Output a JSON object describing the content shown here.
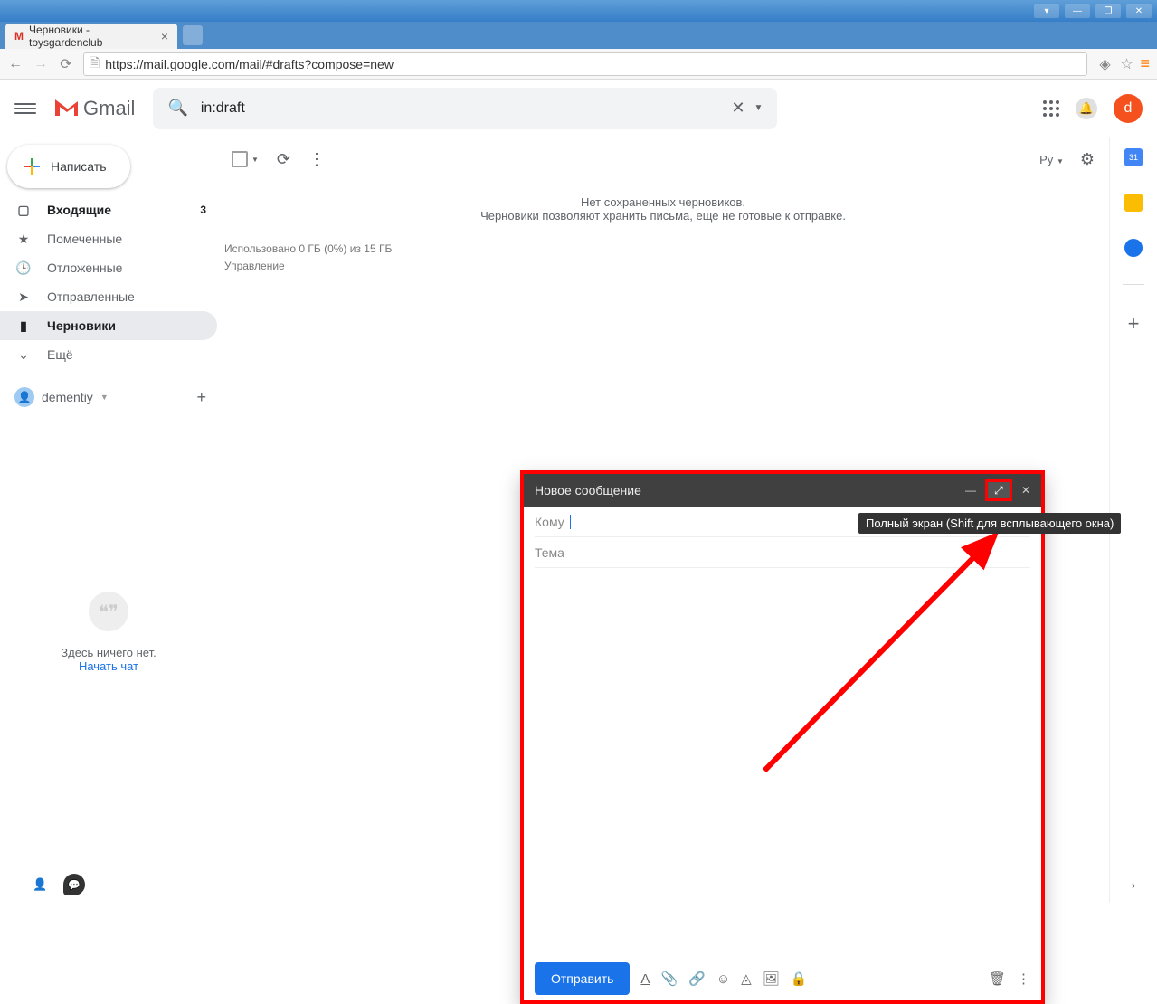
{
  "browser": {
    "tab_title": "Черновики - toysgardenclub",
    "url": "https://mail.google.com/mail/#drafts?compose=new"
  },
  "header": {
    "brand": "Gmail",
    "search_value": "in:draft",
    "avatar_letter": "d"
  },
  "sidebar": {
    "compose": "Написать",
    "items": [
      {
        "icon": "inbox",
        "label": "Входящие",
        "active": false,
        "bold": true,
        "count": "3"
      },
      {
        "icon": "star",
        "label": "Помеченные"
      },
      {
        "icon": "clock",
        "label": "Отложенные"
      },
      {
        "icon": "send",
        "label": "Отправленные"
      },
      {
        "icon": "file",
        "label": "Черновики",
        "active": true,
        "bold": true
      },
      {
        "icon": "more",
        "label": "Ещё"
      }
    ],
    "user": "dementiy",
    "hangouts_empty_l1": "Здесь ничего нет.",
    "hangouts_empty_link": "Начать чат"
  },
  "toolbar": {
    "lang": "Py"
  },
  "main": {
    "empty_line1": "Нет сохраненных черновиков.",
    "empty_line2": "Черновики позволяют хранить письма, еще не готовые к отправке.",
    "storage_line1": "Использовано 0 ГБ (0%) из 15 ГБ",
    "storage_line2": "Управление"
  },
  "rightbar": {
    "cal_day": "31"
  },
  "compose": {
    "title": "Новое сообщение",
    "to_label": "Кому",
    "subject_label": "Тема",
    "send_label": "Отправить"
  },
  "tooltip": "Полный экран (Shift для всплывающего окна)"
}
